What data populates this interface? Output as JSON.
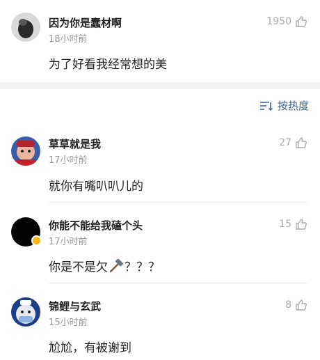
{
  "sort": {
    "label": "按热度"
  },
  "comments": [
    {
      "author": "因为你是蠢材啊",
      "time": "18小时前",
      "text": "为了好看我经常想的美",
      "likes": "1950"
    },
    {
      "author": "草草就是我",
      "time": "17小时前",
      "text": "就你有嘴叭叭儿的",
      "likes": "27"
    },
    {
      "author": "你能不能给我磕个头",
      "time": "17小时前",
      "text_before": "你是不是欠",
      "text_after": "？？？",
      "inline_icon": "hammer-icon",
      "likes": "15"
    },
    {
      "author": "锦鲤与玄武",
      "time": "15小时前",
      "text": "尬尬，有被谢到",
      "likes": "8"
    }
  ],
  "colors": {
    "accent_link": "#3f5f88",
    "muted": "#9a9a9a",
    "badge": "#f2b81b",
    "band": "#f2f2f2"
  }
}
